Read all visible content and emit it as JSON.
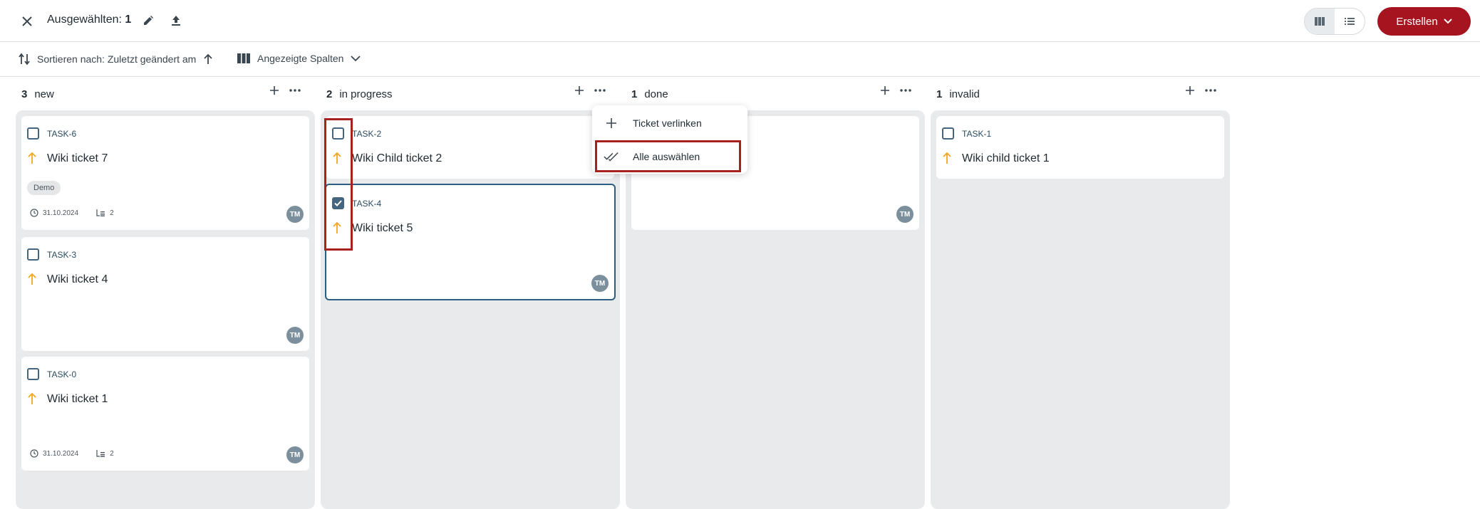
{
  "header": {
    "selected_label": "Ausgewählten:",
    "selected_count": "1",
    "create_label": "Erstellen"
  },
  "toolbar": {
    "sort_label": "Sortieren nach: Zuletzt geändert am",
    "columns_label": "Angezeigte Spalten"
  },
  "columns": [
    {
      "count": "3",
      "name": "new"
    },
    {
      "count": "2",
      "name": "in progress"
    },
    {
      "count": "1",
      "name": "done"
    },
    {
      "count": "1",
      "name": "invalid"
    }
  ],
  "cards": {
    "task6": {
      "id": "TASK-6",
      "title": "Wiki ticket 7",
      "tag": "Demo",
      "date": "31.10.2024",
      "children": "2",
      "avatar": "TM"
    },
    "task3": {
      "id": "TASK-3",
      "title": "Wiki ticket 4",
      "avatar": "TM"
    },
    "task0": {
      "id": "TASK-0",
      "title": "Wiki ticket 1",
      "date": "31.10.2024",
      "children": "2",
      "avatar": "TM"
    },
    "task2": {
      "id": "TASK-2",
      "title": "Wiki Child ticket 2"
    },
    "task4": {
      "id": "TASK-4",
      "title": "Wiki ticket 5",
      "avatar": "TM",
      "checked": true
    },
    "done_card": {
      "avatar": "TM"
    },
    "task1": {
      "id": "TASK-1",
      "title": "Wiki child ticket 1"
    }
  },
  "menu": {
    "link_ticket": "Ticket verlinken",
    "select_all": "Alle auswählen"
  },
  "colors": {
    "accent": "#a5141f",
    "priority": "#f0a81c",
    "checkbox": "#45657e",
    "highlight": "#a8211f"
  }
}
